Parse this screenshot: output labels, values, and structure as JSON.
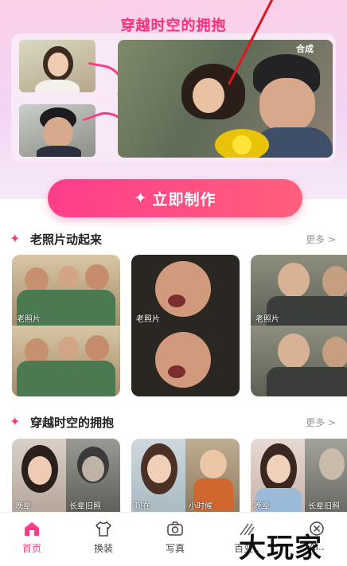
{
  "hero": {
    "title": "穿越时空的拥抱",
    "result_label": "合成"
  },
  "cta": {
    "label": "立即制作"
  },
  "sections": [
    {
      "title": "老照片动起来",
      "more": "更多 >",
      "cards": [
        {
          "tag": "老照片"
        },
        {
          "tag": "老照片"
        },
        {
          "tag": "老照片"
        }
      ]
    },
    {
      "title": "穿越时空的拥抱",
      "more": "更多 >",
      "cards": [
        {
          "left_tag": "晚辈",
          "right_tag": "长辈旧照"
        },
        {
          "left_tag": "现在",
          "right_tag": "小时候"
        },
        {
          "left_tag": "晚辈",
          "right_tag": "长辈旧照"
        }
      ]
    }
  ],
  "tabs": [
    {
      "label": "首页",
      "icon": "home-icon",
      "active": true
    },
    {
      "label": "换装",
      "icon": "shirt-icon",
      "active": false
    },
    {
      "label": "写真",
      "icon": "camera-icon",
      "active": false
    },
    {
      "label": "百变..",
      "icon": "magic-icon",
      "active": false
    },
    {
      "label": "AI..",
      "icon": "close-circle-icon",
      "active": false
    }
  ],
  "watermark": "大玩家",
  "colors": {
    "accent": "#ff3c84",
    "title_pink": "#ff2f78"
  }
}
